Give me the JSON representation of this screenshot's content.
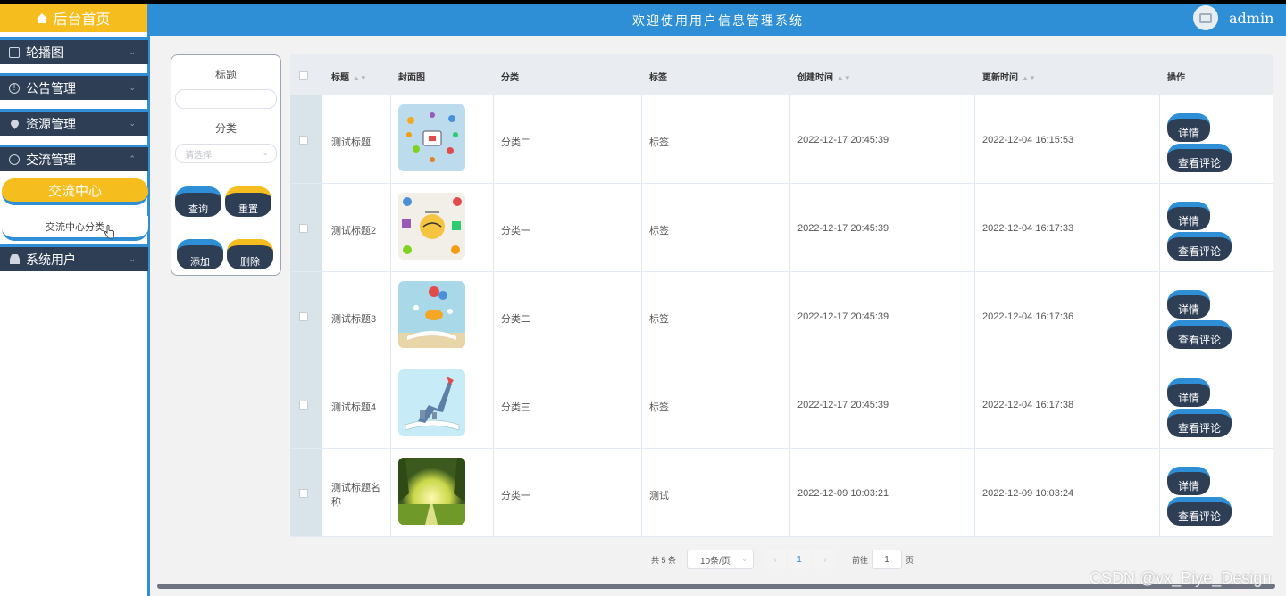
{
  "sidebar": {
    "home_label": "后台首页",
    "menus": [
      {
        "label": "轮播图",
        "icon": "picture-icon"
      },
      {
        "label": "公告管理",
        "icon": "info-icon"
      },
      {
        "label": "资源管理",
        "icon": "location-pin-icon"
      },
      {
        "label": "交流管理",
        "icon": "chat-icon",
        "expanded": true
      },
      {
        "label": "系统用户",
        "icon": "user-icon"
      }
    ],
    "submenu_active": "交流中心",
    "submenu_item": "交流中心分类"
  },
  "header": {
    "title": "欢迎使用用户信息管理系统",
    "user_name": "admin"
  },
  "search": {
    "title_label": "标题",
    "title_value": "",
    "category_label": "分类",
    "category_placeholder": "请选择",
    "query_button": "查询",
    "reset_button": "重置",
    "add_button": "添加",
    "delete_button": "删除"
  },
  "table": {
    "headers": {
      "title": "标题",
      "cover": "封面图",
      "category": "分类",
      "tag": "标签",
      "created": "创建时间",
      "updated": "更新时间",
      "actions": "操作"
    },
    "detail_label": "详情",
    "comment_label": "查看评论",
    "rows": [
      {
        "title": "测试标题",
        "category": "分类二",
        "tag": "标签",
        "created": "2022-12-17 20:45:39",
        "updated": "2022-12-04 16:15:53"
      },
      {
        "title": "测试标题2",
        "category": "分类一",
        "tag": "标签",
        "created": "2022-12-17 20:45:39",
        "updated": "2022-12-04 16:17:33"
      },
      {
        "title": "测试标题3",
        "category": "分类二",
        "tag": "标签",
        "created": "2022-12-17 20:45:39",
        "updated": "2022-12-04 16:17:36"
      },
      {
        "title": "测试标题4",
        "category": "分类三",
        "tag": "标签",
        "created": "2022-12-17 20:45:39",
        "updated": "2022-12-04 16:17:38"
      },
      {
        "title": "测试标题名称",
        "category": "分类一",
        "tag": "测试",
        "created": "2022-12-09 10:03:21",
        "updated": "2022-12-09 10:03:24"
      }
    ]
  },
  "pagination": {
    "total_text": "共 5 条",
    "page_size": "10条/页",
    "current_page": "1",
    "goto_prefix": "前往",
    "goto_value": "1",
    "goto_suffix": "页"
  },
  "watermark": "CSDN @vx_Biye_Design",
  "colors": {
    "accent_blue": "#2e8fd6",
    "accent_yellow": "#f5bd1e",
    "dark_navy": "#2d3e55"
  }
}
